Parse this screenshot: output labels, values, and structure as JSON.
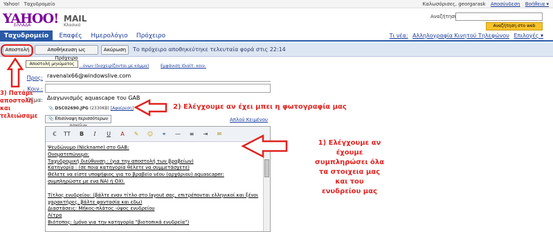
{
  "utilbar": {
    "left": [
      "Yahoo!",
      "Ταχυδρομείο"
    ],
    "right_greeting": "Καλωσόρισες, georgarask",
    "logout": "Αποσύνδεση",
    "help": "Βοήθεια ▾"
  },
  "header": {
    "logo": "YAHOO!",
    "logo_sub": "ΕΛΛΑΔΑ",
    "mail": "MAIL",
    "mail_sub": "Κλασικό",
    "search_label": "Αναζήτηση:",
    "search_value": "",
    "search_button": "Αναζήτηση στο web"
  },
  "nav": {
    "tabs": [
      "Ταχυδρομείο",
      "Επαφές",
      "Ημερολόγιο",
      "Πρόχειρο"
    ],
    "right": [
      "Τι νέα:",
      "Αλληλογραφία Κινητού Τηλεφώνου",
      "Επιλογές ▾"
    ]
  },
  "toolbar": {
    "send": "Αποστολή",
    "save_draft": "Αποθήκευση ως Πρόχειρο",
    "cancel": "Ακύρωση",
    "saved_note": "Το πρόχειρο αποθηκεύτηκε τελευταία φορά στις 22:14"
  },
  "tooltip": "Αποστολή μηνύματος",
  "form": {
    "contacts_link": "...ύνων (διαχειρίζονται με κόμμα)",
    "show_cc_link": "Εμφάνιση Ιδιαίτ. κοιν.",
    "to_label": "Προς:",
    "to_value": "ravenalx66@windowslive.com",
    "cc_label": "Κοιν.:",
    "cc_value": "",
    "subject_label": "Θέμα:",
    "subject_value": "Διαγωνισμός aquascape του GAB",
    "attachment_name": "DSC02690.JPG",
    "attachment_size": "(2330KB)",
    "attachment_remove": "[Αφαίρεση]",
    "attach_more": "Επισύναψη περισσότερων αρχείων",
    "plain_text_link": "Απλού Κειμένου"
  },
  "editor": {
    "toolbar_icons": [
      "font-icon",
      "font-size-icon",
      "bold-icon",
      "italic-icon",
      "underline-icon",
      "text-color-icon",
      "highlight-icon",
      "emoticon-icon",
      "link-icon",
      "hr-icon",
      "list-icon",
      "indent-icon",
      "stationery-icon"
    ],
    "fmt_labels": [
      "Ꞓ",
      "TT",
      "B",
      "I",
      "U",
      "A",
      "✎",
      "☺",
      "⚭",
      "—",
      "≡",
      "⇥",
      "✉"
    ],
    "lines": [
      "Ψευδώνυμο (Nickname) στο GAB:",
      "Ονοματεπώνυμο:",
      "Ταχυδρομική διεύθυνση : (για την αποστολή των βραβείων)",
      "Κατηγορία : (σε ποια κατηγορία θέλετε να συμμετάσχετε)",
      "Θέλετε να είστε υποψήφιος για το βραβείο νέου (αρχάριου) aquascaper:",
      "συμπληρώστε με ενα ΝΑΙ ή ΟΧΙ.",
      "",
      "Τίτλος ενυδρείου: (βάλτε εναν τίτλο στο layout σας, επιτρέπονται ελληνικοί και ξένοι",
      "χαρακτήρες, βάλτε φαντασία και εδω)",
      "Διαστάσεις: Μήκος-πλάτος -ύψος ενυδρείου",
      "Λίτρα",
      "Βιότοπος: (μόνο για την κατηγορία \"βιοτοπικά ενυδρεία\")"
    ]
  },
  "annotations": {
    "step1": [
      "1) Ελέγχουμε αν",
      "έχουμε",
      "συμπληρώσει όλα",
      "τα στοιχεια μας",
      "και του",
      "ενυδρείου μας"
    ],
    "step2": "2) Ελέγχουμε αν έχει μπει η φωτογραφία μας",
    "step3": [
      "3) Πατάμε",
      "αποστολή και",
      "τελειώσαμε"
    ],
    "color": "#e0221f"
  }
}
